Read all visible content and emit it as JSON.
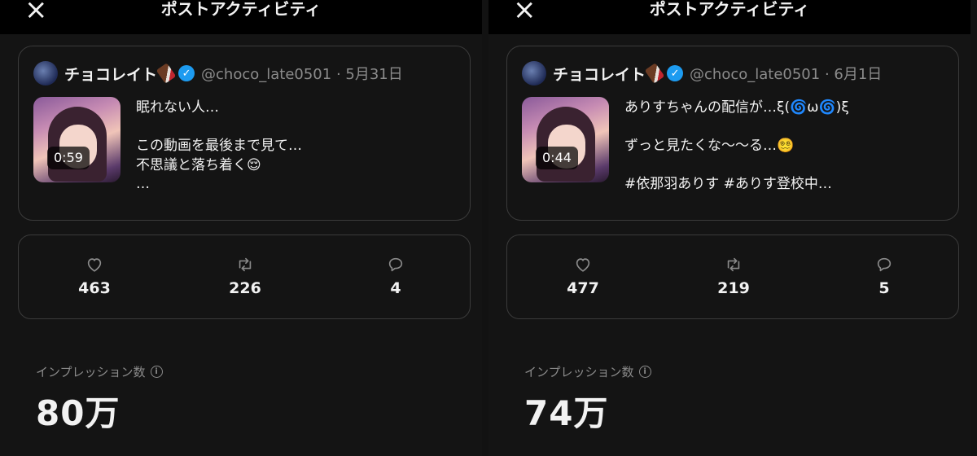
{
  "screens": [
    {
      "title": "ポストアクティビティ",
      "close_icon": "×",
      "post": {
        "author_name": "チョコレイト",
        "handle": "@choco_late0501",
        "date": "5月31日",
        "video_duration": "0:59",
        "text": "眠れない人…\n\nこの動画を最後まで見て…\n不思議と落ち着く😌\n…"
      },
      "stats": {
        "likes": "463",
        "reposts": "226",
        "replies": "4"
      },
      "impressions_label": "インプレッション数",
      "impressions_value": "80万"
    },
    {
      "title": "ポストアクティビティ",
      "close_icon": "×",
      "post": {
        "author_name": "チョコレイト",
        "handle": "@choco_late0501",
        "date": "6月1日",
        "video_duration": "0:44",
        "text": "ありすちゃんの配信が…ξ(🌀ω🌀)ξ\n\nずっと見たくな〜〜る…😵‍💫\n\n#依那羽ありす #ありす登校中…"
      },
      "stats": {
        "likes": "477",
        "reposts": "219",
        "replies": "5"
      },
      "impressions_label": "インプレッション数",
      "impressions_value": "74万"
    }
  ],
  "colors": {
    "background": "#141414",
    "topbar": "#000000",
    "border": "#3b3b3b",
    "verified": "#1d9bf0",
    "muted": "#8b8b8b"
  },
  "icons": {
    "close": "close-icon",
    "like": "heart-icon",
    "repost": "repost-icon",
    "reply": "reply-icon",
    "verified": "verified-badge-icon",
    "info": "info-icon"
  }
}
